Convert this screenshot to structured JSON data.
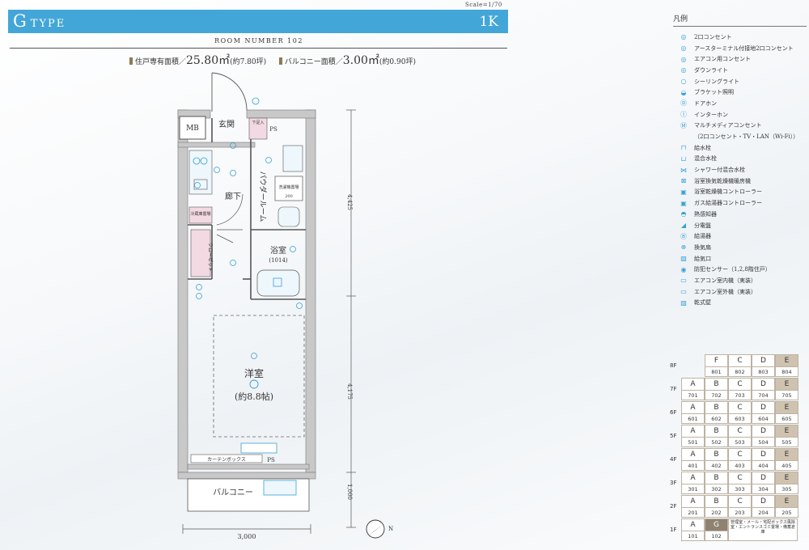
{
  "header": {
    "scale": "Scale=1/70",
    "type_letter": "G",
    "type_word": "TYPE",
    "layout": "1K",
    "room_number": "ROOM NUMBER 102",
    "area_label": "住戸専有面積／",
    "area_value": "25.80㎡",
    "area_tsubo": "(約7.80坪)",
    "balcony_label": "バルコニー面積／",
    "balcony_value": "3.00㎡",
    "balcony_tsubo": "(約0.90坪)"
  },
  "plan": {
    "rooms": {
      "mb": "MB",
      "entrance": "玄関",
      "shoes": "下足入",
      "ps_top": "PS",
      "hall": "廊下",
      "powder": "パウダールーム",
      "washer": "洗濯機置場",
      "washer_sub": "200",
      "closet": "クローゼット",
      "bath": "浴室",
      "bath_size": "(1014)",
      "western": "洋室",
      "western_size": "(約8.8帖)",
      "curtain": "カーテンボックス",
      "ps_bottom": "PS",
      "balcony": "バルコニー",
      "fridge": "冷蔵庫置場"
    },
    "dims": {
      "width": "3,000",
      "d1": "4,425",
      "d2": "4,175",
      "d3": "1,000"
    },
    "north": "N"
  },
  "legend": {
    "title": "凡例",
    "items": [
      {
        "icon": "double-outlet-icon",
        "glyph": "◎",
        "text": "2口コンセント"
      },
      {
        "icon": "earth-outlet-icon",
        "glyph": "◎",
        "text": "アースターミナル付接地2口コンセント"
      },
      {
        "icon": "aircon-outlet-icon",
        "glyph": "◎",
        "text": "エアコン用コンセント"
      },
      {
        "icon": "downlight-icon",
        "glyph": "◎",
        "text": "ダウンライト"
      },
      {
        "icon": "ceiling-light-icon",
        "glyph": "○",
        "text": "シーリングライト"
      },
      {
        "icon": "bracket-light-icon",
        "glyph": "◒",
        "text": "ブラケット照明"
      },
      {
        "icon": "doorphone-icon",
        "glyph": "Ⓓ",
        "text": "ドアホン"
      },
      {
        "icon": "intercom-icon",
        "glyph": "Ⓘ",
        "text": "インターホン"
      },
      {
        "icon": "multimedia-outlet-icon",
        "glyph": "Ⓜ",
        "text": "マルチメディアコンセント"
      },
      {
        "icon": "multimedia-sub-icon",
        "glyph": "",
        "text": "（2口コンセント・TV・LAN（Wi-Fi））"
      },
      {
        "icon": "water-tap-icon",
        "glyph": "⊓",
        "text": "給水栓"
      },
      {
        "icon": "mixer-tap-icon",
        "glyph": "⊔",
        "text": "混合水栓"
      },
      {
        "icon": "shower-tap-icon",
        "glyph": "⋈",
        "text": "シャワー付混合水栓"
      },
      {
        "icon": "bath-dryer-icon",
        "glyph": "⊠",
        "text": "浴室換気乾燥機暖房機"
      },
      {
        "icon": "dryer-controller-icon",
        "glyph": "▣",
        "text": "浴室乾燥機コントローラー"
      },
      {
        "icon": "gas-controller-icon",
        "glyph": "▣",
        "text": "ガス給湯器コントローラー"
      },
      {
        "icon": "heat-sensor-icon",
        "glyph": "◓",
        "text": "熱感知器"
      },
      {
        "icon": "distribution-board-icon",
        "glyph": "◢",
        "text": "分電盤"
      },
      {
        "icon": "water-heater-icon",
        "glyph": "Ⓑ",
        "text": "給湯器"
      },
      {
        "icon": "vent-fan-icon",
        "glyph": "⊗",
        "text": "換気扇"
      },
      {
        "icon": "air-intake-icon",
        "glyph": "▨",
        "text": "給気口"
      },
      {
        "icon": "security-sensor-icon",
        "glyph": "◉",
        "text": "防犯センサー（1,2,8階住戸）"
      },
      {
        "icon": "aircon-indoor-icon",
        "glyph": "▭",
        "text": "エアコン室内機（実装）"
      },
      {
        "icon": "aircon-outdoor-icon",
        "glyph": "▭",
        "text": "エアコン室外機（実装）"
      },
      {
        "icon": "dry-wall-icon",
        "glyph": "▧",
        "text": "乾式壁"
      }
    ]
  },
  "floor_key": {
    "floors": [
      {
        "floor": "8F",
        "units": [
          {
            "letter": "",
            "num": ""
          },
          {
            "letter": "F",
            "num": "801"
          },
          {
            "letter": "C",
            "num": "802"
          },
          {
            "letter": "D",
            "num": "803"
          },
          {
            "letter": "E",
            "num": "804"
          }
        ]
      },
      {
        "floor": "7F",
        "units": [
          {
            "letter": "A",
            "num": "701"
          },
          {
            "letter": "B",
            "num": "702"
          },
          {
            "letter": "C",
            "num": "703"
          },
          {
            "letter": "D",
            "num": "704"
          },
          {
            "letter": "E",
            "num": "705"
          }
        ]
      },
      {
        "floor": "6F",
        "units": [
          {
            "letter": "A",
            "num": "601"
          },
          {
            "letter": "B",
            "num": "602"
          },
          {
            "letter": "C",
            "num": "603"
          },
          {
            "letter": "D",
            "num": "604"
          },
          {
            "letter": "E",
            "num": "605"
          }
        ]
      },
      {
        "floor": "5F",
        "units": [
          {
            "letter": "A",
            "num": "501"
          },
          {
            "letter": "B",
            "num": "502"
          },
          {
            "letter": "C",
            "num": "503"
          },
          {
            "letter": "D",
            "num": "504"
          },
          {
            "letter": "E",
            "num": "505"
          }
        ]
      },
      {
        "floor": "4F",
        "units": [
          {
            "letter": "A",
            "num": "401"
          },
          {
            "letter": "B",
            "num": "402"
          },
          {
            "letter": "C",
            "num": "403"
          },
          {
            "letter": "D",
            "num": "404"
          },
          {
            "letter": "E",
            "num": "405"
          }
        ]
      },
      {
        "floor": "3F",
        "units": [
          {
            "letter": "A",
            "num": "301"
          },
          {
            "letter": "B",
            "num": "302"
          },
          {
            "letter": "C",
            "num": "303"
          },
          {
            "letter": "D",
            "num": "304"
          },
          {
            "letter": "E",
            "num": "305"
          }
        ]
      },
      {
        "floor": "2F",
        "units": [
          {
            "letter": "A",
            "num": "201"
          },
          {
            "letter": "B",
            "num": "202"
          },
          {
            "letter": "C",
            "num": "203"
          },
          {
            "letter": "D",
            "num": "204"
          },
          {
            "letter": "E",
            "num": "205"
          }
        ]
      }
    ],
    "first_floor": {
      "floor": "1F",
      "unit_a": {
        "letter": "A",
        "num": "101"
      },
      "unit_g": {
        "letter": "G",
        "num": "102"
      },
      "common": "管理室・メール・宅配ボックス風除室・エントランスゴミ置場・備蓄倉庫"
    },
    "highlight_letter": "E",
    "current_unit": "102"
  },
  "colors": {
    "accent": "#43a6d8",
    "symbol": "#3a9fd6",
    "wall": "#c8c8c8",
    "closet": "#f3d9e2",
    "current": "#8f8270",
    "highlight": "#cfc3b0"
  }
}
